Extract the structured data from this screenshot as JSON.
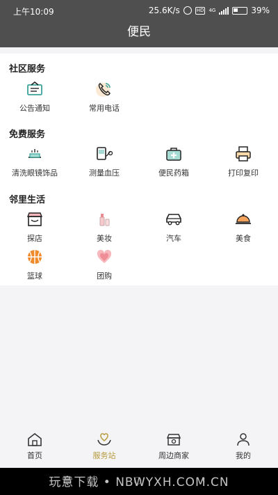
{
  "status": {
    "time": "上午10:09",
    "speed": "25.6K/s",
    "hd": "HD",
    "network": "4G",
    "battery": "39%"
  },
  "header": {
    "title": "便民"
  },
  "sections": [
    {
      "title": "社区服务",
      "items": [
        {
          "label": "公告通知",
          "icon": "notice-board-icon"
        },
        {
          "label": "常用电话",
          "icon": "phone-icon"
        }
      ]
    },
    {
      "title": "免费服务",
      "items": [
        {
          "label": "清洗眼镜饰品",
          "icon": "cleaning-icon"
        },
        {
          "label": "测量血压",
          "icon": "blood-pressure-icon"
        },
        {
          "label": "便民药箱",
          "icon": "medicine-box-icon"
        },
        {
          "label": "打印复印",
          "icon": "printer-icon"
        }
      ]
    },
    {
      "title": "邻里生活",
      "items": [
        {
          "label": "探店",
          "icon": "shop-icon"
        },
        {
          "label": "美妆",
          "icon": "makeup-icon"
        },
        {
          "label": "汽车",
          "icon": "car-icon"
        },
        {
          "label": "美食",
          "icon": "dining-icon"
        },
        {
          "label": "篮球",
          "icon": "basketball-icon"
        },
        {
          "label": "团购",
          "icon": "group-buy-icon"
        }
      ]
    }
  ],
  "tabs": [
    {
      "label": "首页",
      "icon": "home-icon",
      "active": false
    },
    {
      "label": "服务站",
      "icon": "heart-hands-icon",
      "active": true
    },
    {
      "label": "周边商家",
      "icon": "store-icon",
      "active": false
    },
    {
      "label": "我的",
      "icon": "user-icon",
      "active": false
    }
  ],
  "watermark": "玩意下载 • NBWYXH.COM.CN",
  "colors": {
    "bar": "#4f4f4f",
    "accent": "#b79a3d",
    "teal": "#3aa39a",
    "orange": "#e8892b",
    "pink": "#e98a93"
  }
}
